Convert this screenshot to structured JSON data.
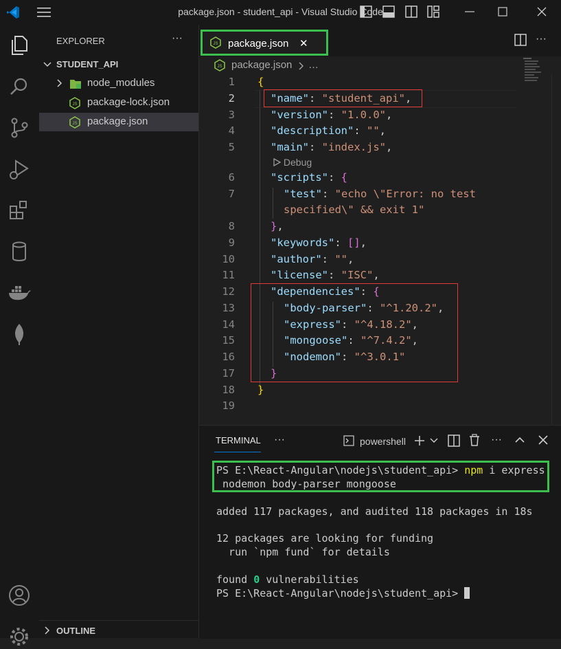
{
  "titlebar": {
    "title": "package.json - student_api - Visual Studio Code"
  },
  "activity_bar": {
    "icons": [
      "explorer-icon",
      "search-icon",
      "source-control-icon",
      "run-debug-icon",
      "extensions-icon",
      "database-icon",
      "docker-icon",
      "mongodb-icon",
      "account-icon",
      "settings-icon"
    ]
  },
  "sidebar": {
    "header": "EXPLORER",
    "more": "···",
    "project": "STUDENT_API",
    "items": [
      {
        "label": "node_modules",
        "type": "folder"
      },
      {
        "label": "package-lock.json",
        "type": "file"
      },
      {
        "label": "package.json",
        "type": "file",
        "selected": true
      }
    ],
    "outline": "OUTLINE"
  },
  "editor": {
    "tab_label": "package.json",
    "tab_close": "✕",
    "breadcrumb_file": "package.json",
    "breadcrumb_more": "…",
    "codelens": "Debug",
    "lines": {
      "l1": "{",
      "l2_key": "\"name\"",
      "l2_val": "\"student_api\"",
      "l3_key": "\"version\"",
      "l3_val": "\"1.0.0\"",
      "l4_key": "\"description\"",
      "l4_val": "\"\"",
      "l5_key": "\"main\"",
      "l5_val": "\"index.js\"",
      "l6_key": "\"scripts\"",
      "l7_key": "\"test\"",
      "l7_val_a": "\"echo \\\"Error: no test",
      "l7_val_b": "specified\\\" && exit 1\"",
      "l9_key": "\"keywords\"",
      "l9_val": "[]",
      "l10_key": "\"author\"",
      "l10_val": "\"\"",
      "l11_key": "\"license\"",
      "l11_val": "\"ISC\"",
      "l12_key": "\"dependencies\"",
      "l13_key": "\"body-parser\"",
      "l13_val": "\"^1.20.2\"",
      "l14_key": "\"express\"",
      "l14_val": "\"^4.18.2\"",
      "l15_key": "\"mongoose\"",
      "l15_val": "\"^7.4.2\"",
      "l16_key": "\"nodemon\"",
      "l16_val": "\"^3.0.1\""
    },
    "line_numbers": [
      "1",
      "2",
      "3",
      "4",
      "5",
      "6",
      "7",
      "8",
      "9",
      "10",
      "11",
      "12",
      "13",
      "14",
      "15",
      "16",
      "17",
      "18",
      "19"
    ],
    "active_line": "2"
  },
  "panel": {
    "tab": "TERMINAL",
    "more": "···",
    "shell": "powershell",
    "terminal": {
      "prompt": "PS E:\\React-Angular\\nodejs\\student_api>",
      "cmd_npm": "npm",
      "cmd_rest": "i express",
      "cmd_wrap": " nodemon body-parser mongoose",
      "added": "added 117 packages, and audited 118 packages in 18s",
      "funding_1": "12 packages are looking for funding",
      "funding_2": "  run `npm fund` for details",
      "found_a": "found ",
      "found_zero": "0",
      "found_b": " vulnerabilities"
    }
  },
  "colors": {
    "highlight_green": "#3bbf4e",
    "highlight_red": "#e53935",
    "json_key": "#9cdcfe",
    "json_string": "#ce9178"
  }
}
